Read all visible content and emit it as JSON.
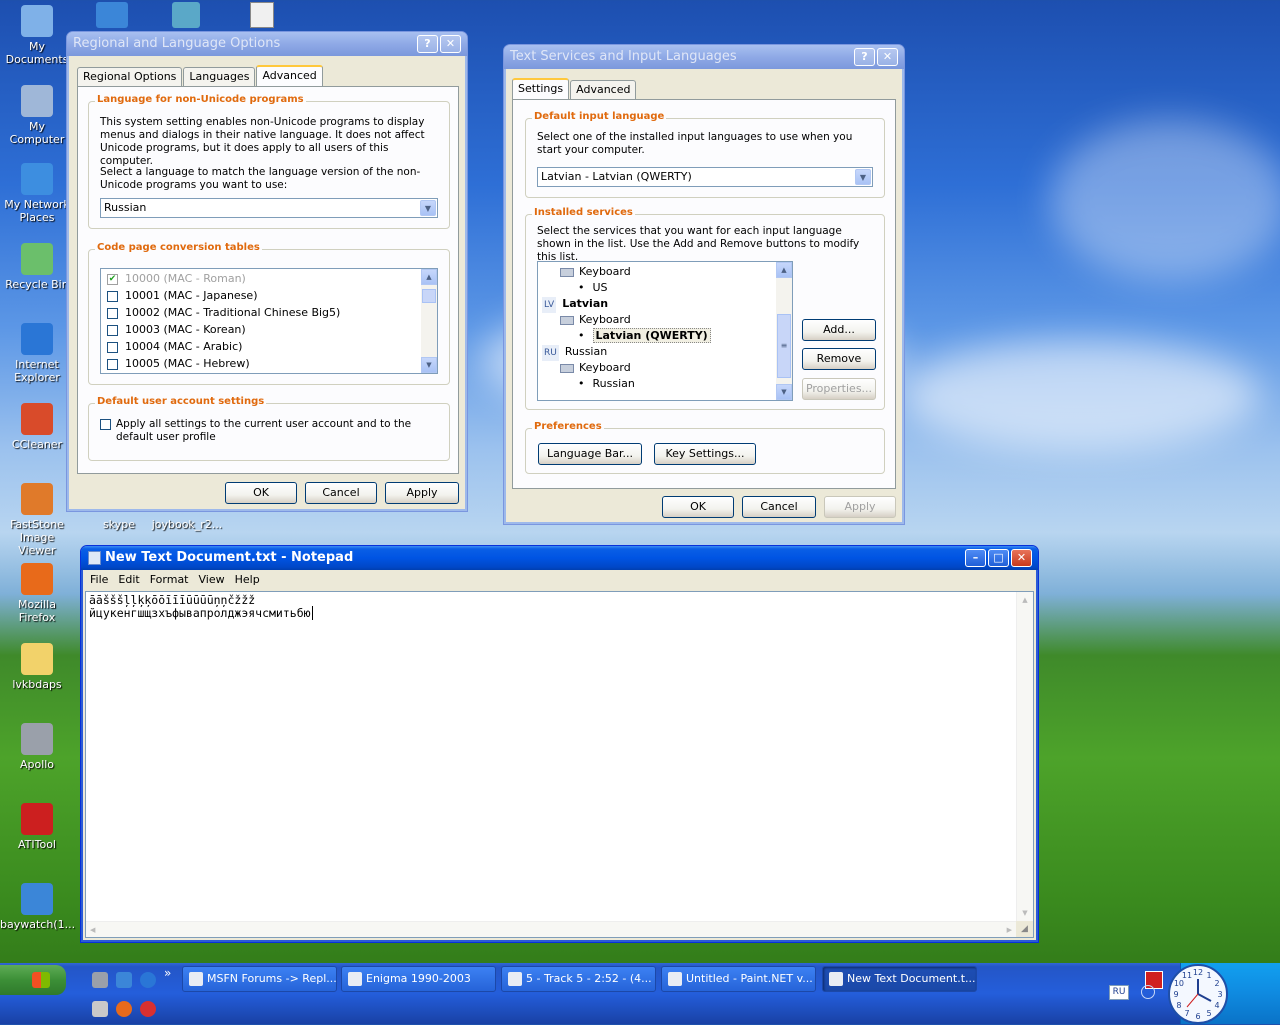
{
  "desktop": {
    "icons": [
      {
        "label": "My Documents",
        "icon": "documents-icon",
        "color": "#7fb1e8"
      },
      {
        "label": "My Computer",
        "icon": "computer-icon",
        "color": "#9fb7d8"
      },
      {
        "label": "My Network Places",
        "icon": "network-icon",
        "color": "#3d8ee0"
      },
      {
        "label": "Recycle Bin",
        "icon": "recycle-bin-icon",
        "color": "#6bbf6b"
      },
      {
        "label": "Internet Explorer",
        "icon": "internet-explorer-icon",
        "color": "#2a76d6"
      },
      {
        "label": "CCleaner",
        "icon": "ccleaner-icon",
        "color": "#d94b2a"
      },
      {
        "label": "FastStone Image Viewer",
        "icon": "faststone-icon",
        "color": "#e07a2a"
      },
      {
        "label": "Mozilla Firefox",
        "icon": "firefox-icon",
        "color": "#e86a1a"
      },
      {
        "label": "lvkbdaps",
        "icon": "folder-icon",
        "color": "#f2d26a"
      },
      {
        "label": "Apollo",
        "icon": "apollo-icon",
        "color": "#9aa0aa"
      },
      {
        "label": "ATITool",
        "icon": "atitool-icon",
        "color": "#cc1f1f"
      },
      {
        "label": "baywatch(1...",
        "icon": "wmv-file-icon",
        "color": "#3b86d8"
      }
    ],
    "extra_labels": {
      "skype": "skype",
      "joybook": "joybook_r2..."
    }
  },
  "regional": {
    "title": "Regional and Language Options",
    "help_btn": "?",
    "close_btn": "✕",
    "tabs": [
      "Regional Options",
      "Languages",
      "Advanced"
    ],
    "group1_title": "Language for non-Unicode programs",
    "group1_text1": "This system setting enables non-Unicode programs to display menus and dialogs in their native language. It does not affect Unicode programs, but it does apply to all users of this computer.",
    "group1_text2": "Select a language to match the language version of the non-Unicode programs you want to use:",
    "language_value": "Russian",
    "group2_title": "Code page conversion tables",
    "codepages": [
      {
        "label": "10000 (MAC - Roman)",
        "checked": true,
        "disabled": true
      },
      {
        "label": "10001 (MAC - Japanese)",
        "checked": false,
        "disabled": false
      },
      {
        "label": "10002 (MAC - Traditional Chinese Big5)",
        "checked": false,
        "disabled": false
      },
      {
        "label": "10003 (MAC - Korean)",
        "checked": false,
        "disabled": false
      },
      {
        "label": "10004 (MAC - Arabic)",
        "checked": false,
        "disabled": false
      },
      {
        "label": "10005 (MAC - Hebrew)",
        "checked": false,
        "disabled": false
      }
    ],
    "group3_title": "Default user account settings",
    "group3_text": "Apply all settings to the current user account and to the default user profile",
    "ok": "OK",
    "cancel": "Cancel",
    "apply": "Apply"
  },
  "textservices": {
    "title": "Text Services and Input Languages",
    "help_btn": "?",
    "close_btn": "✕",
    "tabs": [
      "Settings",
      "Advanced"
    ],
    "group1_title": "Default input language",
    "group1_text": "Select one of the installed input languages to use when you start your computer.",
    "default_lang": "Latvian - Latvian (QWERTY)",
    "group2_title": "Installed services",
    "group2_text": "Select the services that you want for each input language shown in the list. Use the Add and Remove buttons to modify this list.",
    "tree": [
      {
        "indent": 1,
        "badge": "",
        "text": "Keyboard",
        "bold": false,
        "icon": true
      },
      {
        "indent": 2,
        "badge": "",
        "text": "US",
        "bold": false,
        "bullet": true
      },
      {
        "indent": 0,
        "badge": "LV",
        "text": "Latvian",
        "bold": true
      },
      {
        "indent": 1,
        "badge": "",
        "text": "Keyboard",
        "bold": false,
        "icon": true
      },
      {
        "indent": 2,
        "badge": "",
        "text": "Latvian (QWERTY)",
        "bold": true,
        "bullet": true,
        "selected": true
      },
      {
        "indent": 0,
        "badge": "RU",
        "text": "Russian",
        "bold": false
      },
      {
        "indent": 1,
        "badge": "",
        "text": "Keyboard",
        "bold": false,
        "icon": true
      },
      {
        "indent": 2,
        "badge": "",
        "text": "Russian",
        "bold": false,
        "bullet": true
      }
    ],
    "add": "Add...",
    "remove": "Remove",
    "properties": "Properties...",
    "group3_title": "Preferences",
    "language_bar": "Language Bar...",
    "key_settings": "Key Settings...",
    "ok": "OK",
    "cancel": "Cancel",
    "apply": "Apply"
  },
  "notepad": {
    "title": "New Text Document.txt - Notepad",
    "menu": [
      "File",
      "Edit",
      "Format",
      "View",
      "Help"
    ],
    "line1": "āāšššļļķķōōīīīūūūūņņčžžž",
    "line2": "йцукенгшщзхъфывапролджэячсмитьбю"
  },
  "taskbar": {
    "start": "start",
    "more": "»",
    "tasks": [
      {
        "label": "MSFN Forums -> Repl...",
        "icon": "opera-icon"
      },
      {
        "label": "Enigma 1990-2003",
        "icon": "folder-icon"
      },
      {
        "label": "5  - Track 5 - 2:52 - (4...",
        "icon": "apollo-icon"
      },
      {
        "label": "Untitled - Paint.NET v...",
        "icon": "paintnet-icon"
      },
      {
        "label": "New Text Document.t...",
        "icon": "notepad-icon"
      }
    ],
    "lang_indicator": "RU",
    "clock_numbers": [
      "12",
      "1",
      "2",
      "3",
      "4",
      "5",
      "6",
      "7",
      "8",
      "9",
      "10",
      "11"
    ]
  }
}
